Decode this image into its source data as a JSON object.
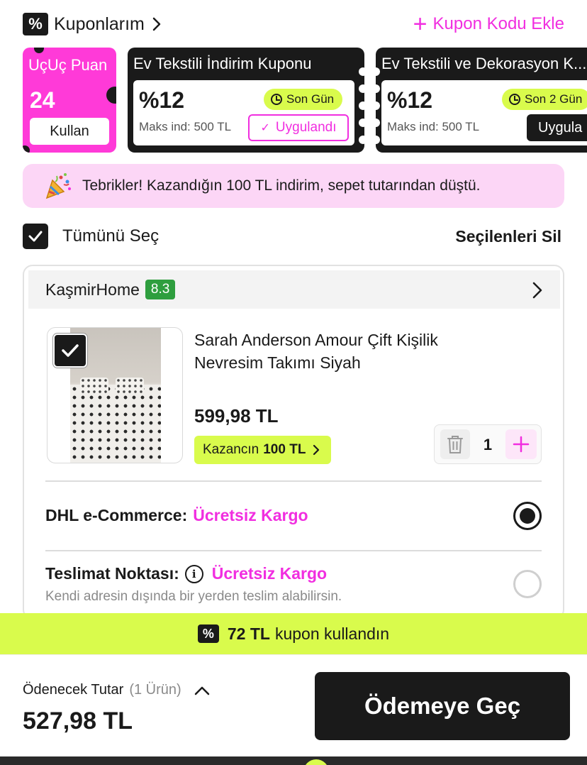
{
  "header": {
    "coupons_title": "Kuponlarım",
    "add_coupon_label": "Kupon Kodu Ekle",
    "percent_glyph": "%"
  },
  "points_card": {
    "title": "UçUç Puan",
    "value": "24",
    "button_label": "Kullan"
  },
  "coupons": [
    {
      "name": "Ev Tekstili İndirim Kuponu",
      "discount": "%12",
      "max_discount": "Maks ind: 500 TL",
      "deadline": "Son Gün",
      "status_label": "Uygulandı"
    },
    {
      "name": "Ev Tekstili ve Dekorasyon K...",
      "discount": "%12",
      "max_discount": "Maks ind: 500 TL",
      "deadline": "Son 2 Gün",
      "action_label": "Uygula"
    }
  ],
  "congrats": {
    "icon": "party-popper",
    "text": "Tebrikler! Kazandığın 100 TL indirim, sepet tutarından düştü."
  },
  "selection": {
    "select_all_label": "Tümünü Seç",
    "delete_selected_label": "Seçilenleri Sil"
  },
  "seller": {
    "name": "KaşmirHome",
    "score": "8.3",
    "product": {
      "title": "Sarah Anderson Amour Çift Kişilik Nevresim Takımı Siyah",
      "price": "599,98 TL",
      "earn_prefix": "Kazancın",
      "earn_amount": "100 TL",
      "quantity": "1"
    },
    "shipping": [
      {
        "label": "DHL e-Commerce:",
        "value": "Ücretsiz Kargo",
        "selected": true
      },
      {
        "label": "Teslimat Noktası:",
        "value": "Ücretsiz Kargo",
        "subtext": "Kendi adresin dışında bir yerden teslim alabilirsin.",
        "selected": false
      }
    ]
  },
  "coupon_used": {
    "amount": "72 TL",
    "text": "kupon kullandın"
  },
  "footer": {
    "total_label": "Ödenecek Tutar",
    "item_count": "(1 Ürün)",
    "total": "527,98 TL",
    "checkout_label": "Ödemeye Geç"
  },
  "colors": {
    "accent_pink": "#f12ee0",
    "lime": "#d9fb4c",
    "dark": "#1a1a1a",
    "score_green": "#2e9e3e",
    "congrats_bg": "#fcd6f6"
  }
}
